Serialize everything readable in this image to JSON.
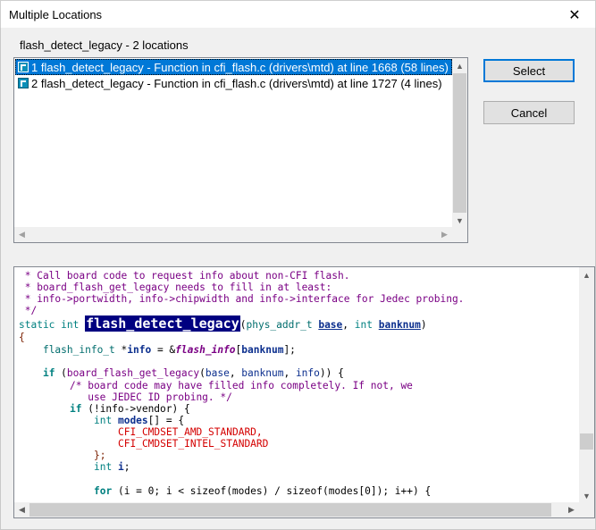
{
  "window": {
    "title": "Multiple Locations",
    "close_glyph": "✕"
  },
  "heading": "flash_detect_legacy - 2 locations",
  "locations": [
    {
      "label": "1 flash_detect_legacy - Function in cfi_flash.c (drivers\\mtd) at line 1668 (58 lines)",
      "icon": "function-icon",
      "selected": true
    },
    {
      "label": "2 flash_detect_legacy - Function in cfi_flash.c (drivers\\mtd) at line 1727 (4 lines)",
      "icon": "function-icon",
      "selected": false
    }
  ],
  "buttons": {
    "select": "Select",
    "cancel": "Cancel"
  },
  "colors": {
    "selection": "#0078d7",
    "highlight": "#000080",
    "comment": "#7a0084",
    "keyword": "#008080",
    "macro": "#d40000"
  },
  "code": {
    "l1": " * Call board code to request info about non-CFI flash.",
    "l2": " * board_flash_get_legacy needs to fill in at least:",
    "l3": " * info->portwidth, info->chipwidth and info->interface for Jedec probing.",
    "l4": " */",
    "l5_static": "static",
    "l5_int": "int",
    "l5_name": "flash_detect_legacy",
    "l5_open": "(",
    "l5_type": "phys_addr_t",
    "l5_base": "base",
    "l5_comma": ", ",
    "l5_int2": "int",
    "l5_banknum": "banknum",
    "l5_close": ")",
    "l6": "{",
    "l7_type": "flash_info_t",
    "l7_star": " *",
    "l7_info": "info",
    "l7_eq": " = &",
    "l7_global": "flash_info",
    "l7_idx_open": "[",
    "l7_idx": "banknum",
    "l7_idx_close": "];",
    "l9_if": "if",
    "l9_open": " (",
    "l9_fn": "board_flash_get_legacy",
    "l9_args_open": "(",
    "l9_base": "base",
    "l9_c1": ", ",
    "l9_banknum": "banknum",
    "l9_c2": ", ",
    "l9_info": "info",
    "l9_close": ")) {",
    "l10": "/* board code may have filled info completely. If not, we",
    "l11": "   use JEDEC ID probing. */",
    "l12_if": "if",
    "l12_rest": " (!info->vendor) {",
    "l13_int": "int",
    "l13_modes": "modes",
    "l13_rest": "[] = {",
    "l14": "CFI_CMDSET_AMD_STANDARD,",
    "l15": "CFI_CMDSET_INTEL_STANDARD",
    "l16": "};",
    "l17_int": "int",
    "l17_i": "i",
    "l17_semi": ";",
    "l19_for": "for",
    "l19_rest": " (i = 0; i < sizeof(modes) / sizeof(modes[0]); i++) {"
  }
}
